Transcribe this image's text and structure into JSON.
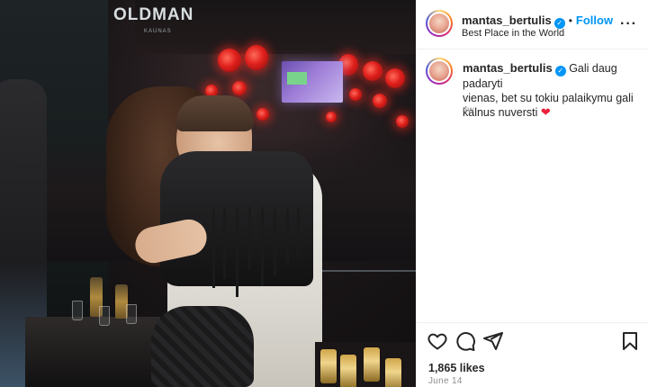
{
  "post": {
    "photo_sign": "OLDMAN",
    "photo_sign_sub": "KAUNAS",
    "author": {
      "username": "mantas_bertulis",
      "verified_mark": "✓",
      "follow_separator": "•",
      "follow_label": "Follow",
      "location": "Best Place in the World"
    },
    "more_icon": "more-options-icon",
    "caption": {
      "username": "mantas_bertulis",
      "verified_mark": "✓",
      "text_line1": "Gali daug padaryti",
      "text_line2": "vienas, bet su tokiu palaikymu gali",
      "text_line3": "kalnus nuversti",
      "emoji": "❤",
      "age": "4w"
    },
    "actions": {
      "like_icon": "heart-icon",
      "comment_icon": "comment-icon",
      "share_icon": "share-icon",
      "save_icon": "bookmark-icon"
    },
    "likes": "1,865 likes",
    "date": "June 14"
  },
  "colors": {
    "accent": "#0095f6",
    "text": "#262626",
    "secondary": "#8e8e8e",
    "heart": "#ed1f3a"
  }
}
